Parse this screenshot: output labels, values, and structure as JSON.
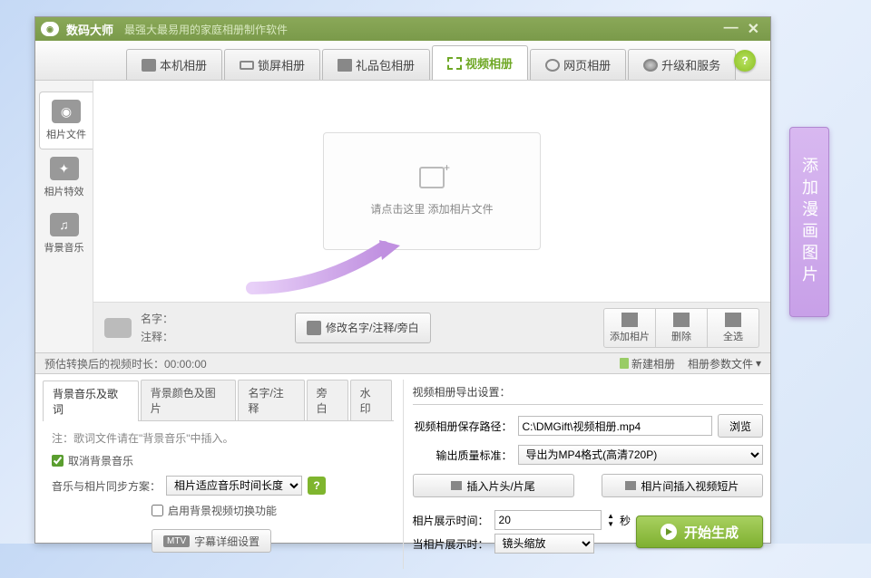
{
  "titlebar": {
    "app_name": "数码大师",
    "subtitle": "最强大最易用的家庭相册制作软件"
  },
  "tabs": {
    "t0": "本机相册",
    "t1": "锁屏相册",
    "t2": "礼品包相册",
    "t3": "视频相册",
    "t4": "网页相册",
    "t5": "升级和服务"
  },
  "sidebar": {
    "s0": "相片文件",
    "s1": "相片特效",
    "s2": "背景音乐"
  },
  "drop": {
    "text": "请点击这里  添加相片文件"
  },
  "meta": {
    "name_lbl": "名字：",
    "note_lbl": "注释：",
    "edit_btn": "修改名字/注释/旁白"
  },
  "tools": {
    "add": "添加相片",
    "del": "删除",
    "all": "全选"
  },
  "status": {
    "estimate": "预估转换后的视频时长：00:00:00",
    "new_album": "新建相册",
    "params": "相册参数文件"
  },
  "subtabs": {
    "st0": "背景音乐及歌词",
    "st1": "背景颜色及图片",
    "st2": "名字/注释",
    "st3": "旁白",
    "st4": "水印"
  },
  "left_panel": {
    "note": "注：歌词文件请在\"背景音乐\"中插入。",
    "cancel_bgm": "取消背景音乐",
    "sync_lbl": "音乐与相片同步方案：",
    "sync_opt": "相片适应音乐时间长度",
    "enable_switch": "启用背景视频切换功能",
    "mtv_tag": "MTV",
    "subtitle_btn": "字幕详细设置"
  },
  "right_panel": {
    "title": "视频相册导出设置：",
    "path_lbl": "视频相册保存路径：",
    "path_val": "C:\\DMGift\\视频相册.mp4",
    "browse": "浏览",
    "quality_lbl": "输出质量标准：",
    "quality_opt": "导出为MP4格式(高清720P)",
    "insert_head": "插入片头/片尾",
    "insert_clip": "相片间插入视频短片",
    "show_time_lbl": "相片展示时间：",
    "show_time_val": "20",
    "seconds": "秒",
    "current_lbl": "当相片展示时：",
    "current_opt": "镜头缩放",
    "start": "开始生成"
  },
  "annotation": "添加漫画图片"
}
